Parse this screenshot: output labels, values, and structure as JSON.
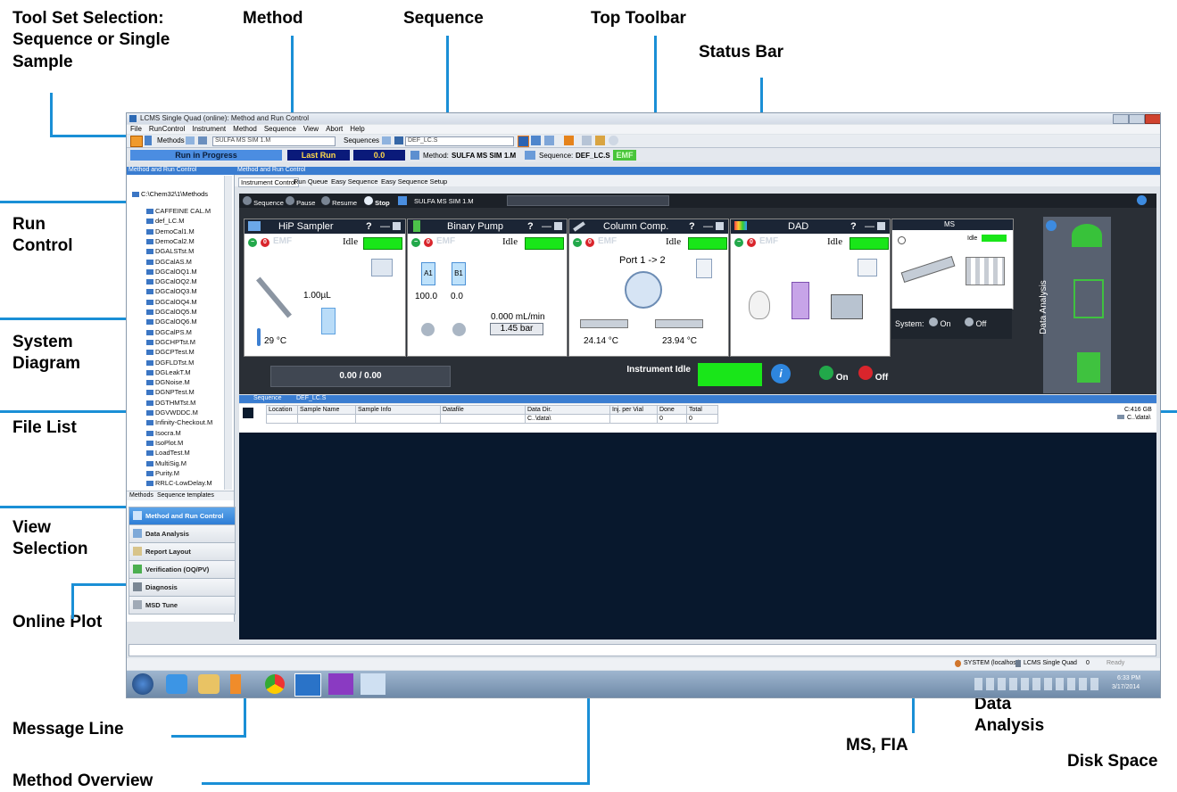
{
  "annotations": {
    "tool_set": [
      "Tool Set Selection:",
      "Sequence or Single",
      "Sample"
    ],
    "method": "Method",
    "sequence": "Sequence",
    "top_toolbar": "Top Toolbar",
    "status_bar": "Status Bar",
    "run_control": [
      "Run",
      "Control"
    ],
    "system_diagram": [
      "System",
      "Diagram"
    ],
    "file_list": "File List",
    "view_selection": [
      "View",
      "Selection"
    ],
    "online_plot": "Online Plot",
    "message_line": "Message Line",
    "method_overview": "Method Overview",
    "ms_fia": "MS, FIA",
    "data_analysis": [
      "Data",
      "Analysis"
    ],
    "disk_space": "Disk Space"
  },
  "window": {
    "title": "LCMS Single Quad (online): Method and Run Control",
    "menu": [
      "File",
      "RunControl",
      "Instrument",
      "Method",
      "Sequence",
      "View",
      "Abort",
      "Help"
    ]
  },
  "toolbar": {
    "methods_label": "Methods",
    "method_value": "SULFA MS SIM 1.M",
    "sequences_label": "Sequences",
    "sequence_value": "DEF_LC.S"
  },
  "status": {
    "run_state": "Run in Progress",
    "last_run": "Last Run",
    "value": "0.0",
    "method_label": "Method:",
    "method_name": "SULFA MS SIM 1.M",
    "sequence_label": "Sequence:",
    "sequence_name": "DEF_LC.S",
    "emf": "EMF"
  },
  "left_panel": {
    "header": "Method and Run Control",
    "root": "C:\\Chem32\\1\\Methods",
    "files": [
      "CAFFEINE CAL.M",
      "def_LC.M",
      "DemoCal1.M",
      "DemoCal2.M",
      "DGALSTst.M",
      "DGCalAS.M",
      "DGCalOQ1.M",
      "DGCalOQ2.M",
      "DGCalOQ3.M",
      "DGCalOQ4.M",
      "DGCalOQ5.M",
      "DGCalOQ6.M",
      "DGCalPS.M",
      "DGCHPTst.M",
      "DGCPTest.M",
      "DGFLDTst.M",
      "DGLeakT.M",
      "DGNoise.M",
      "DGNPTest.M",
      "DGTHMTst.M",
      "DGVWDDC.M",
      "Infinity-Checkout.M",
      "Isocra.M",
      "IsoPlot.M",
      "LoadTest.M",
      "MultiSig.M",
      "Purity.M",
      "RRLC-LowDelay.M"
    ],
    "tabs": [
      "Methods",
      "Sequence templates"
    ],
    "views": [
      "Method and Run Control",
      "Data Analysis",
      "Report Layout",
      "Verification (OQ/PV)",
      "Diagnosis",
      "MSD Tune"
    ]
  },
  "main": {
    "header": "Method and Run Control",
    "tabs": [
      "Instrument Control",
      "Run Queue",
      "Easy Sequence",
      "Easy Sequence Setup"
    ],
    "run_controls": [
      "Sequence",
      "Pause",
      "Resume",
      "Stop"
    ],
    "current_method": "SULFA MS SIM 1.M",
    "modules": {
      "sampler": {
        "title": "HiP Sampler",
        "state": "Idle",
        "volume": "1.00µL",
        "temp": "29 °C"
      },
      "pump": {
        "title": "Binary Pump",
        "state": "Idle",
        "a1": "A1",
        "b1": "B1",
        "a1_val": "100.0",
        "b1_val": "0.0",
        "flow": "0.000 mL/min",
        "pressure": "1.45 bar"
      },
      "column": {
        "title": "Column Comp.",
        "state": "Idle",
        "port": "Port 1 -> 2",
        "t_left": "24.14 °C",
        "t_right": "23.94 °C"
      },
      "dad": {
        "title": "DAD",
        "state": "Idle"
      },
      "ms": {
        "title": "MS",
        "state": "Idle",
        "system_label": "System:",
        "on": "On",
        "off": "Off"
      }
    },
    "counter": "0.00 / 0.00",
    "instrument_state": "Instrument Idle",
    "on": "On",
    "off": "Off",
    "data_analysis": "Data Analysis"
  },
  "sequence_table": {
    "header_label": "Sequence",
    "header_name": "DEF_LC.S",
    "columns": [
      "Location",
      "Sample Name",
      "Sample Info",
      "Datafile",
      "Data Dir.",
      "Inj. per Vial",
      "Done",
      "Total"
    ],
    "row": [
      "",
      "",
      "",
      "",
      "C..\\data\\",
      "",
      "0",
      "0"
    ],
    "disk": "C:416 GB",
    "disk_path": "C..\\data\\"
  },
  "bottom_status": {
    "user": "SYSTEM (localhost)",
    "instrument": "LCMS Single Quad",
    "count": "0",
    "ready": "Ready",
    "time": "6:33 PM",
    "date": "3/17/2014"
  }
}
